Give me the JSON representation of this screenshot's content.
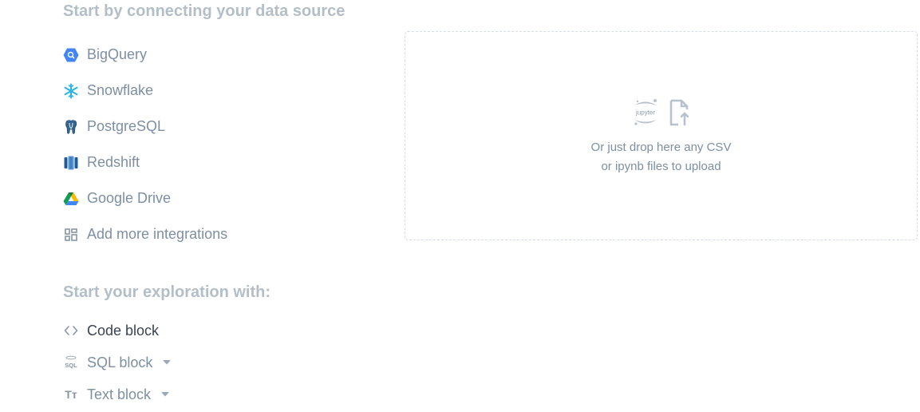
{
  "connect": {
    "title": "Start by connecting your data source",
    "sources": [
      {
        "label": "BigQuery",
        "icon": "bigquery-icon"
      },
      {
        "label": "Snowflake",
        "icon": "snowflake-icon"
      },
      {
        "label": "PostgreSQL",
        "icon": "postgresql-icon"
      },
      {
        "label": "Redshift",
        "icon": "redshift-icon"
      },
      {
        "label": "Google Drive",
        "icon": "google-drive-icon"
      },
      {
        "label": "Add more integrations",
        "icon": "integrations-grid-icon"
      }
    ]
  },
  "dropzone": {
    "line1": "Or just drop here any CSV",
    "line2": "or ipynb files to upload",
    "jupyter_text": "jupyter"
  },
  "explore": {
    "title": "Start your exploration with:",
    "items": [
      {
        "label": "Code block",
        "icon": "code-brackets-icon"
      },
      {
        "label": "SQL block",
        "icon": "sql-icon",
        "icon_text": "SQL"
      },
      {
        "label": "Text block",
        "icon": "text-icon",
        "icon_text": "Tт"
      }
    ]
  },
  "colors": {
    "title": "#b3bec9",
    "label": "#7e8fa2",
    "label_dark": "#3a4450",
    "bigquery": "#4285f4",
    "snowflake": "#29b5e8",
    "redshift": "#2e5f9c",
    "postgres": "#336791"
  }
}
